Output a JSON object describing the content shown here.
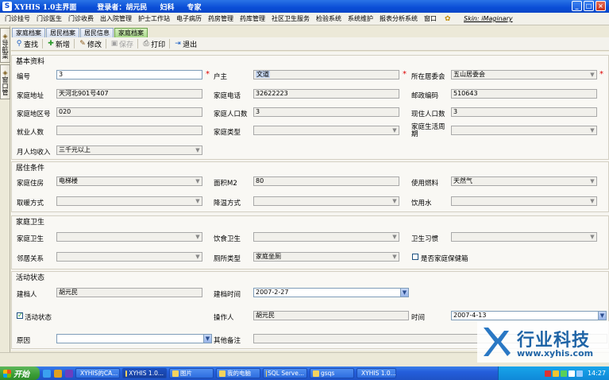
{
  "window": {
    "title": "XYHIS 1.0主界面",
    "user_label": "登录者：胡元民",
    "dept": "妇科",
    "role": "专家",
    "btn_min": "_",
    "btn_max": "□",
    "btn_close": "×"
  },
  "menu": {
    "items": [
      "门诊挂号",
      "门诊医生",
      "门诊收费",
      "出入院管理",
      "护士工作站",
      "电子病历",
      "药房管理",
      "药库管理",
      "社区卫生服务",
      "检验系统",
      "系统维护",
      "报表分析系统",
      "窗口"
    ],
    "skin": "Skin: iMaginary"
  },
  "left_panel": {
    "tab1": "导航菜单",
    "tab2": "窗口管理"
  },
  "tabs": [
    "家庭档案",
    "居民档案",
    "居民信息",
    "家庭档案"
  ],
  "toolbar": {
    "find": "查找",
    "add": "新增",
    "edit": "修改",
    "save": "保存",
    "print": "打印",
    "exit": "退出"
  },
  "sections": {
    "basic": "基本资料",
    "living": "居住条件",
    "hygiene": "家庭卫生",
    "activity": "活动状态"
  },
  "basic": {
    "id_label": "编号",
    "id_value": "3",
    "head_label": "户主",
    "head_value": "文道",
    "committee_label": "所在居委会",
    "committee_value": "五山居委会",
    "addr_label": "家庭地址",
    "addr_value": "天河北901号407",
    "phone_label": "家庭电话",
    "phone_value": "32622223",
    "zip_label": "邮政编码",
    "zip_value": "510643",
    "area_label": "家庭地区号",
    "area_value": "020",
    "pop_label": "家庭人口数",
    "pop_value": "3",
    "current_pop_label": "现住人口数",
    "current_pop_value": "3",
    "employed_label": "就业人数",
    "employed_value": "",
    "type_label": "家庭类型",
    "type_value": "",
    "cycle_label": "家庭生活周期",
    "cycle_value": "",
    "income_label": "月人均收入",
    "income_value": "三千元以上"
  },
  "living": {
    "housing_label": "家庭住房",
    "housing_value": "电梯楼",
    "areasize_label": "面积M2",
    "areasize_value": "80",
    "fuel_label": "使用燃料",
    "fuel_value": "天然气",
    "heating_label": "取暖方式",
    "heating_value": "",
    "cooling_label": "降温方式",
    "cooling_value": "",
    "water_label": "饮用水",
    "water_value": ""
  },
  "hygiene": {
    "home_label": "家庭卫生",
    "home_value": "",
    "food_label": "饮食卫生",
    "food_value": "",
    "habit_label": "卫生习惯",
    "habit_value": "",
    "neighbor_label": "邻居关系",
    "neighbor_value": "",
    "toilet_label": "厕所类型",
    "toilet_value": "家庭坐厕",
    "medkit_label": "是否家庭保健箱",
    "medkit_checked": false
  },
  "activity": {
    "creator_label": "建档人",
    "creator_value": "胡元民",
    "created_label": "建档时间",
    "created_value": "2007-2-27",
    "active_label": "活动状态",
    "active_checked": true,
    "operator_label": "操作人",
    "operator_value": "胡元民",
    "time_label": "时间",
    "time_value": "2007-4-13",
    "reason_label": "原因",
    "reason_value": "",
    "remark_label": "其他备注",
    "remark_value": ""
  },
  "watermark": {
    "cn": "行业科技",
    "url": "www.xyhis.com"
  },
  "taskbar": {
    "start": "开始",
    "tasks": [
      "XYHIS的CA...",
      "XYHIS 1.0...",
      "图片",
      "我的电脑",
      "SQL Serve...",
      "gsqs",
      "XYHIS 1.0..."
    ],
    "clock": "14:27"
  },
  "colors": {
    "title_bar": "#0a4dd6",
    "active_tab": "#a9d98a",
    "required": "#dd0000",
    "watermark": "#1f64a6"
  }
}
